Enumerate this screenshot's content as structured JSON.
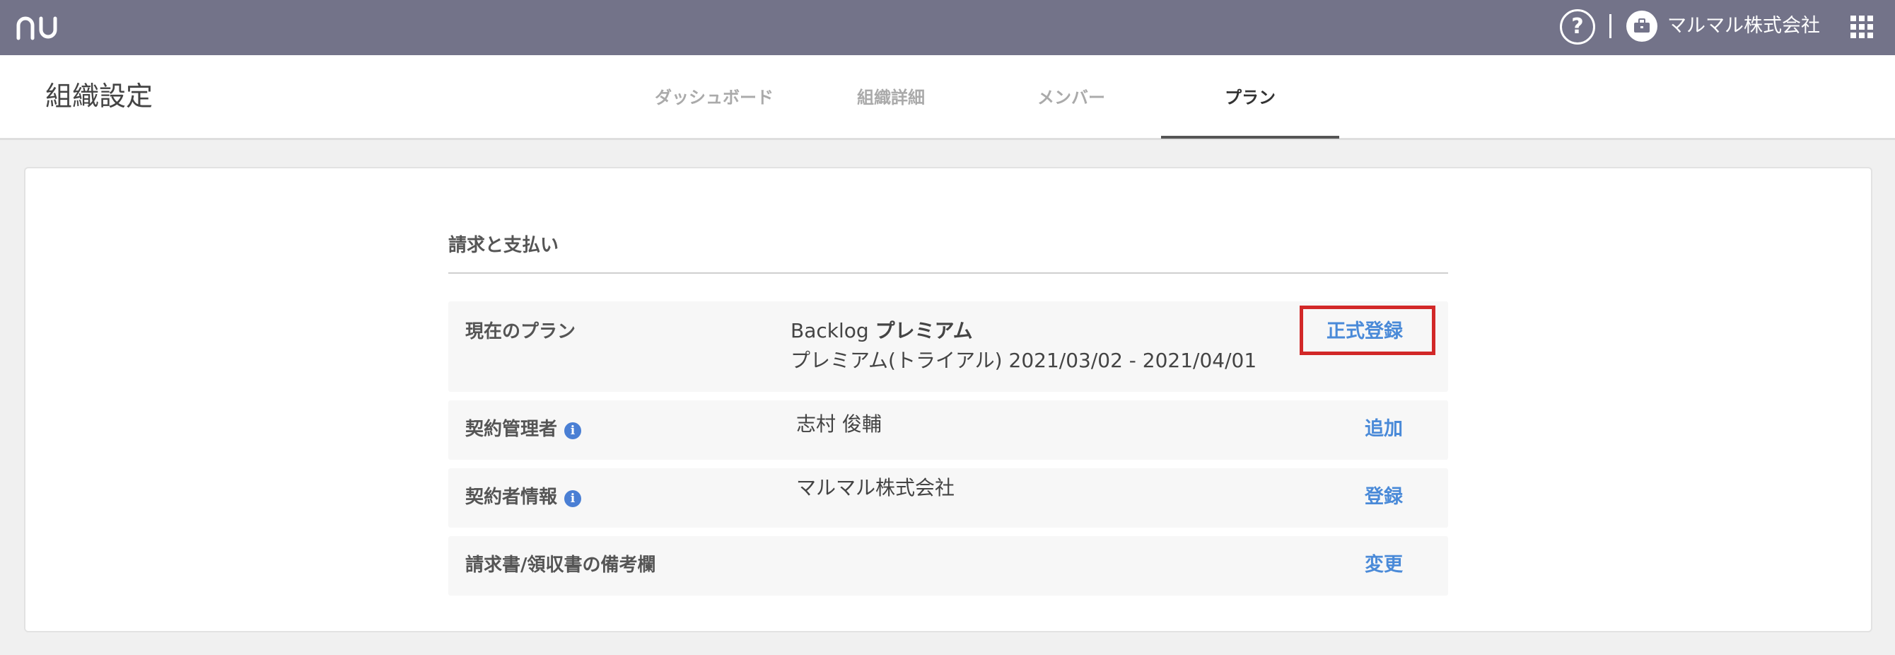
{
  "topbar": {
    "help_label": "?",
    "org_name": "マルマル株式会社"
  },
  "header": {
    "title": "組織設定",
    "tabs": [
      {
        "label": "ダッシュボード"
      },
      {
        "label": "組織詳細"
      },
      {
        "label": "メンバー"
      },
      {
        "label": "プラン"
      }
    ]
  },
  "billing": {
    "section_title": "請求と支払い",
    "rows": [
      {
        "label": "現在のプラン",
        "value_product": "Backlog",
        "value_plan": "プレミアム",
        "value_detail": "プレミアム(トライアル) 2021/03/02 - 2021/04/01",
        "action": "正式登録"
      },
      {
        "label": "契約管理者",
        "value": "志村 俊輔",
        "action": "追加"
      },
      {
        "label": "契約者情報",
        "value": "マルマル株式会社",
        "action": "登録"
      },
      {
        "label": "請求書/領収書の備考欄",
        "value": "",
        "action": "変更"
      }
    ]
  },
  "colors": {
    "topbar": "#737389",
    "link": "#4a8ad8",
    "highlight": "#d22828",
    "info_icon": "#4a7fd4"
  }
}
